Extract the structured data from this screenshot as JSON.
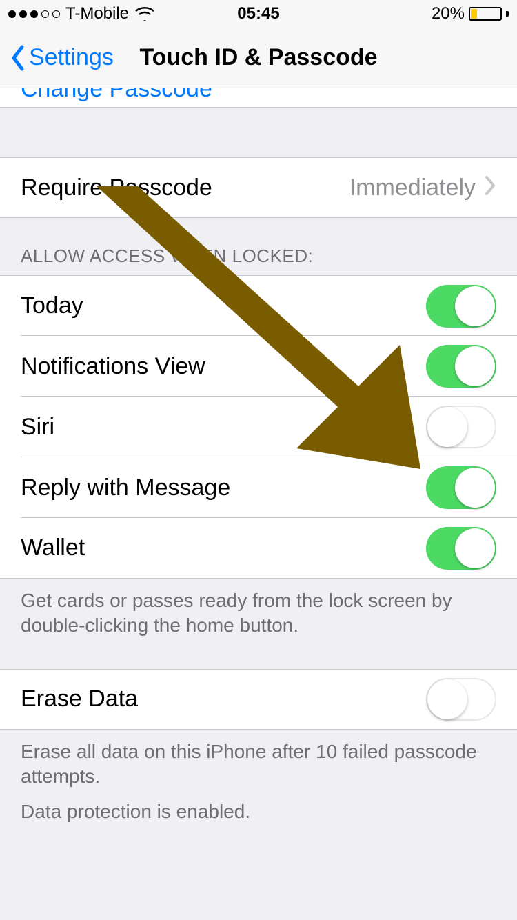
{
  "status_bar": {
    "carrier": "T-Mobile",
    "time": "05:45",
    "battery_percent": "20%"
  },
  "nav": {
    "back_label": "Settings",
    "title": "Touch ID & Passcode"
  },
  "partial_row_text": "Change Passcode",
  "require": {
    "label": "Require Passcode",
    "value": "Immediately"
  },
  "allow_section_header": "ALLOW ACCESS WHEN LOCKED:",
  "toggles": [
    {
      "label": "Today",
      "on": true
    },
    {
      "label": "Notifications View",
      "on": true
    },
    {
      "label": "Siri",
      "on": false
    },
    {
      "label": "Reply with Message",
      "on": true
    },
    {
      "label": "Wallet",
      "on": true
    }
  ],
  "wallet_footer": "Get cards or passes ready from the lock screen by double-clicking the home button.",
  "erase": {
    "label": "Erase Data",
    "on": false,
    "footer1": "Erase all data on this iPhone after 10 failed passcode attempts.",
    "footer2": "Data protection is enabled."
  },
  "annotation": {
    "color": "#7a5c00"
  }
}
